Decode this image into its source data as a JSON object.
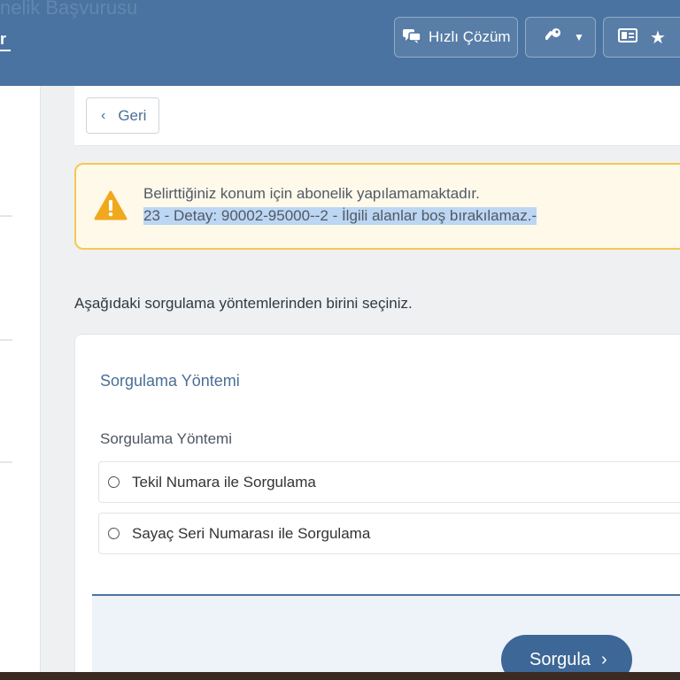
{
  "window": {
    "page_title": "nelik Başvurusu",
    "brand": "r"
  },
  "header": {
    "quick_solution_label": "Hızlı Çözüm",
    "icons": [
      "chat-icon",
      "key-icon",
      "caret-down-icon",
      "id-card-icon",
      "star-icon"
    ]
  },
  "nav": {
    "back_label": "Geri"
  },
  "alert": {
    "line1": "Belirttiğiniz konum için abonelik yapılamamaktadır.",
    "line2": "23 - Detay: 90002-95000--2 - İlgili alanlar boş bırakılamaz.-",
    "icon": "warning-icon",
    "color": "#f3c94f"
  },
  "form": {
    "instruction": "Aşağıdaki sorgulama yöntemlerinden birini seçiniz.",
    "section_title": "Sorgulama Yöntemi",
    "field_label": "Sorgulama Yöntemi",
    "options": [
      {
        "label": "Tekil Numara ile Sorgulama"
      },
      {
        "label": "Sayaç Seri Numarası ile Sorgulama"
      }
    ],
    "submit_label": "Sorgula"
  },
  "colors": {
    "header": "#4a73a1",
    "primary_button": "#3c6796",
    "accent_text": "#4a6f96"
  }
}
